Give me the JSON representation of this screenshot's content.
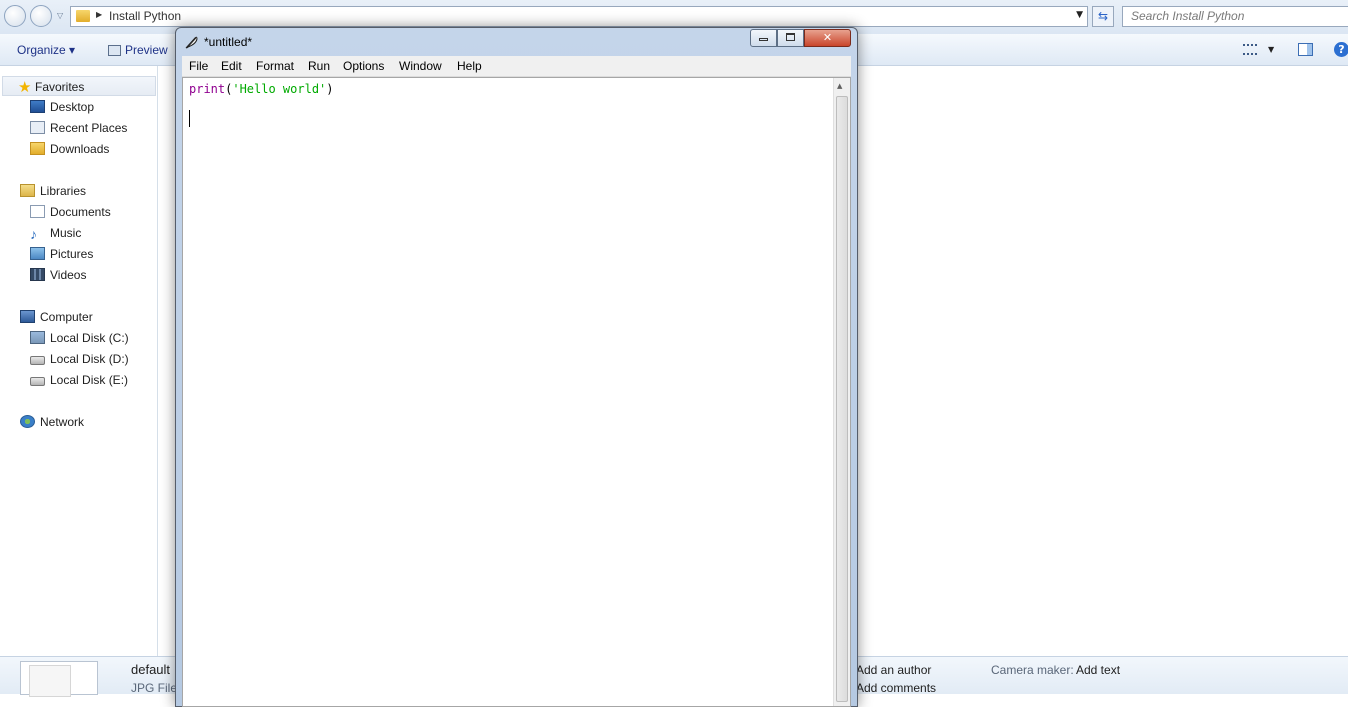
{
  "explorer": {
    "address_path": "Install Python",
    "search_placeholder": "Search Install Python",
    "commands": {
      "organize": "Organize",
      "preview": "Preview"
    },
    "nav": {
      "favorites": "Favorites",
      "desktop": "Desktop",
      "recent_places": "Recent Places",
      "downloads": "Downloads",
      "libraries": "Libraries",
      "documents": "Documents",
      "music": "Music",
      "pictures": "Pictures",
      "videos": "Videos",
      "computer": "Computer",
      "disk_c": "Local Disk (C:)",
      "disk_d": "Local Disk (D:)",
      "disk_e": "Local Disk (E:)",
      "network": "Network"
    },
    "details": {
      "file_name": "default",
      "file_type": "JPG File",
      "author": "Add an author",
      "comments": "Add comments",
      "camera_maker_label": "Camera maker:",
      "camera_maker_value": "Add text"
    }
  },
  "idle": {
    "title": "*untitled*",
    "menu": [
      "File",
      "Edit",
      "Format",
      "Run",
      "Options",
      "Window",
      "Help"
    ],
    "code": {
      "keyword": "print",
      "open_paren": "(",
      "string": "'Hello world'",
      "close_paren": ")"
    }
  }
}
